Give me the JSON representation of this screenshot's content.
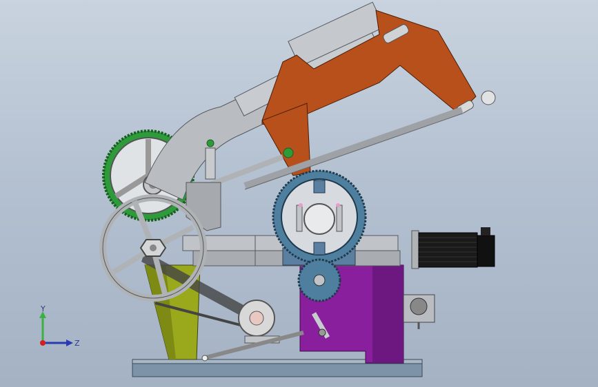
{
  "viewport": {
    "background_top": "#c9d3df",
    "background_bottom": "#a4b2c4"
  },
  "model": {
    "parts": [
      "base-plate",
      "left-leg",
      "right-frame",
      "drive-wheel",
      "handwheel",
      "saw-arm",
      "blade-bow",
      "ring-gear",
      "pinion-gear",
      "servo-motor",
      "belt-idler",
      "vise-jaw",
      "counter-gear"
    ],
    "colors": {
      "steel": "#b9bcc0",
      "base": "#7d93a8",
      "left_leg": "#9aa81c",
      "right_frame": "#8a1f9e",
      "bow": "#b8501c",
      "gear_green": "#2e9b3a",
      "ring_gear": "#4f7f9e",
      "motor": "#1a1a1a"
    }
  },
  "triad": {
    "y_label": "Y",
    "z_label": "Z",
    "y_color": "#3cb043",
    "z_color": "#2a3ab0",
    "x_color": "#d02020"
  }
}
